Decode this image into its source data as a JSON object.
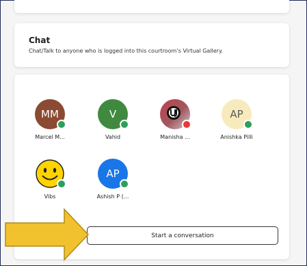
{
  "chat": {
    "title": "Chat",
    "subtitle": "Chat/Talk to anyone who is logged into this courtroom’s Virtual Gallery."
  },
  "participants": [
    {
      "initials": "MM",
      "name": "Marcel M...",
      "avatar_color": "#8b4a32",
      "status_color": "#2e9e5b"
    },
    {
      "initials": "V",
      "name": "Vahid",
      "avatar_color": "#3f8a3f",
      "status_color": "#2e9e5b"
    },
    {
      "initials": "",
      "name": "Manisha ...",
      "avatar_color": "#b04a52",
      "status_color": "#e53935",
      "avatar_icon": "uj-logo-icon"
    },
    {
      "initials": "AP",
      "name": "Anishka Pilli",
      "avatar_color": "#f7ebbd",
      "status_color": "#2e9e5b"
    },
    {
      "initials": "",
      "name": "Vibs",
      "avatar_color": "#ffd400",
      "status_color": "#2e9e5b",
      "avatar_icon": "smiley-face-icon"
    },
    {
      "initials": "AP",
      "name": "Ashish P (...",
      "avatar_color": "#1976e8",
      "status_color": "#2e9e5b"
    }
  ],
  "actions": {
    "start_conversation": "Start a conversation"
  },
  "colors": {
    "frame_border": "#1d2a56",
    "arrow_fill": "#f2c12e",
    "arrow_stroke": "#b08a15"
  }
}
